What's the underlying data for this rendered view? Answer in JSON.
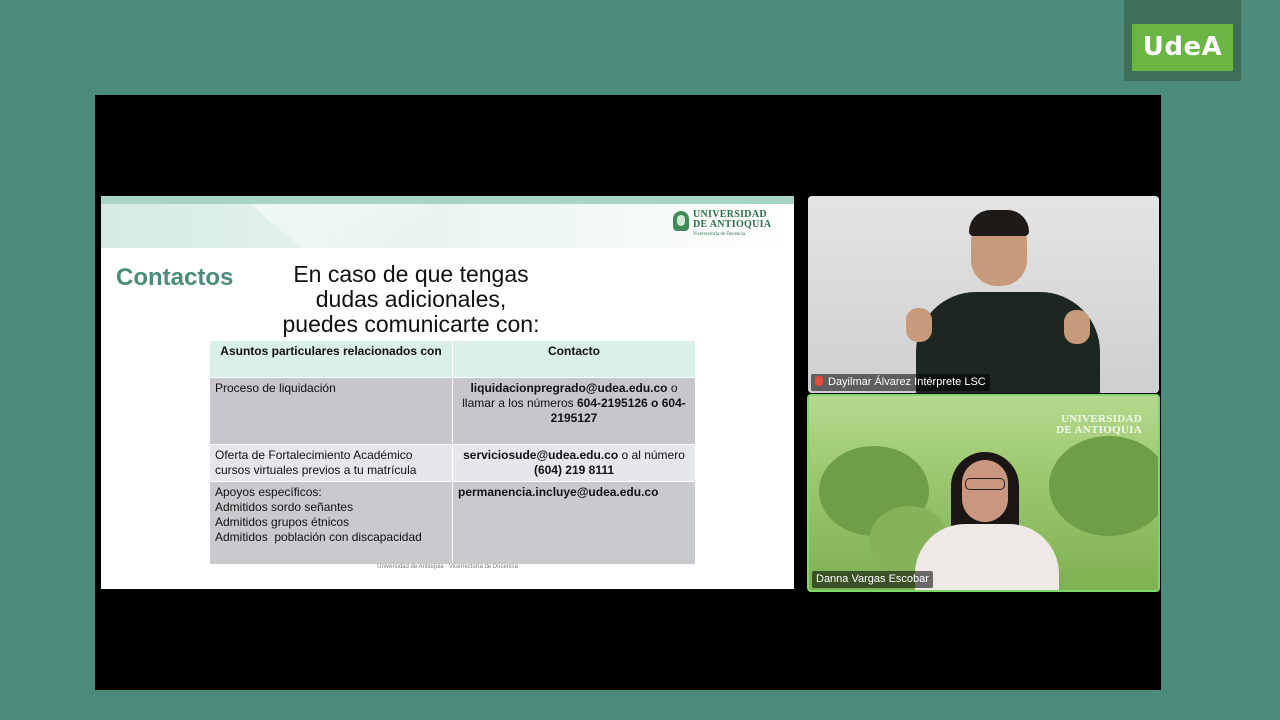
{
  "brand": {
    "logo_text": "UdeA",
    "colors": {
      "background": "#4a8c79",
      "logo_green": "#6ab544",
      "accent_teal": "#d9efe7"
    }
  },
  "slide": {
    "university_name_line1": "UNIVERSIDAD",
    "university_name_line2": "DE ANTIOQUIA",
    "university_subtitle": "Vicerrectoría de Docencia",
    "title": "Contactos",
    "heading_line1": "En caso de que tengas dudas adicionales,",
    "heading_line2": "puedes comunicarte con:",
    "table": {
      "headers": [
        "Asuntos particulares relacionados con",
        "Contacto"
      ],
      "rows": [
        {
          "topic": "Proceso de liquidación",
          "contact_email": "liquidacionpregrado@udea.edu.co",
          "contact_rest_prefix": " o llamar a los números ",
          "contact_phones": "604-2195126 o 604-2195127"
        },
        {
          "topic_line1": "Oferta de Fortalecimiento Académico",
          "topic_line2": "cursos virtuales previos a tu matrícula",
          "contact_email": "serviciosude@udea.edu.co",
          "contact_rest_prefix": " o al número ",
          "contact_phone": "(604) 219 8111"
        },
        {
          "topic_line1": "Apoyos específicos:",
          "topic_line2": "Admitidos sordo señantes",
          "topic_line3": "Admitidos grupos étnicos",
          "topic_line4": "Admitidos  población con discapacidad",
          "contact_email": "permanencia.incluye@udea.edu.co"
        }
      ]
    },
    "footer": "Universidad de Antioquia · Vicerrectoría de Docencia"
  },
  "participants": [
    {
      "name": "Dayilmar Álvarez Intérprete LSC",
      "muted": true
    },
    {
      "name": "Danna Vargas Escobar",
      "muted": false,
      "speaking": true,
      "background_text_line1": "UNIVERSIDAD",
      "background_text_line2": "DE ANTIOQUIA"
    }
  ]
}
